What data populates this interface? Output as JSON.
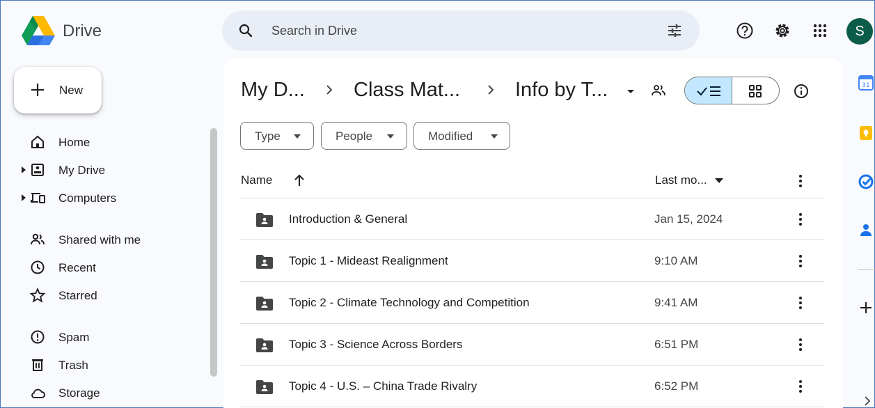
{
  "app": {
    "name": "Drive",
    "avatar_letter": "S",
    "accent": "#c2e7ff"
  },
  "search": {
    "placeholder": "Search in Drive"
  },
  "sidebar": {
    "new_label": "New",
    "items": [
      {
        "label": "Home",
        "icon": "home-icon"
      },
      {
        "label": "My Drive",
        "icon": "my-drive-icon"
      },
      {
        "label": "Computers",
        "icon": "computers-icon"
      },
      {
        "label": "Shared with me",
        "icon": "shared-icon"
      },
      {
        "label": "Recent",
        "icon": "clock-icon"
      },
      {
        "label": "Starred",
        "icon": "star-icon"
      },
      {
        "label": "Spam",
        "icon": "spam-icon"
      },
      {
        "label": "Trash",
        "icon": "trash-icon"
      },
      {
        "label": "Storage",
        "icon": "cloud-icon"
      }
    ]
  },
  "breadcrumb": [
    "My D...",
    "Class Mat...",
    "Info by T..."
  ],
  "filters": [
    "Type",
    "People",
    "Modified"
  ],
  "columns": {
    "name": "Name",
    "modified": "Last mo..."
  },
  "files": [
    {
      "name": "Introduction & General",
      "modified": "Jan 15, 2024"
    },
    {
      "name": "Topic 1 - Mideast Realignment",
      "modified": "9:10 AM"
    },
    {
      "name": "Topic 2 - Climate Technology and Competition",
      "modified": "9:41 AM"
    },
    {
      "name": "Topic 3 - Science Across Borders",
      "modified": "6:51 PM"
    },
    {
      "name": "Topic 4 - U.S. – China Trade Rivalry",
      "modified": "6:52 PM"
    }
  ]
}
